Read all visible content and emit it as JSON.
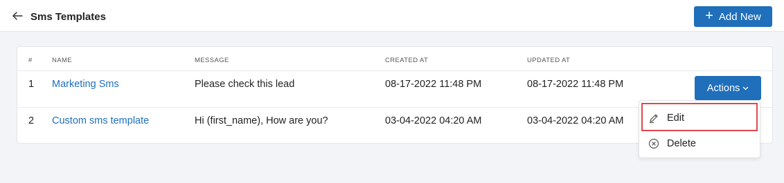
{
  "header": {
    "title": "Sms Templates",
    "add_new_label": "Add New"
  },
  "table": {
    "columns": [
      "#",
      "NAME",
      "MESSAGE",
      "CREATED AT",
      "UPDATED AT"
    ],
    "rows": [
      {
        "index": "1",
        "name": "Marketing Sms",
        "message": "Please check this lead",
        "created_at": "08-17-2022 11:48 PM",
        "updated_at": "08-17-2022 11:48 PM"
      },
      {
        "index": "2",
        "name": "Custom sms template",
        "message": "Hi (first_name), How are you?",
        "created_at": "03-04-2022 04:20 AM",
        "updated_at": "03-04-2022 04:20 AM"
      }
    ]
  },
  "actions_menu": {
    "button_label": "Actions",
    "items": [
      {
        "label": "Edit",
        "icon": "pencil-icon",
        "highlighted": true
      },
      {
        "label": "Delete",
        "icon": "close-circle-icon"
      }
    ]
  },
  "colors": {
    "primary": "#1f6fbb",
    "link": "#1f6fbb",
    "highlight_border": "#e0474c",
    "background": "#f3f4f7"
  }
}
